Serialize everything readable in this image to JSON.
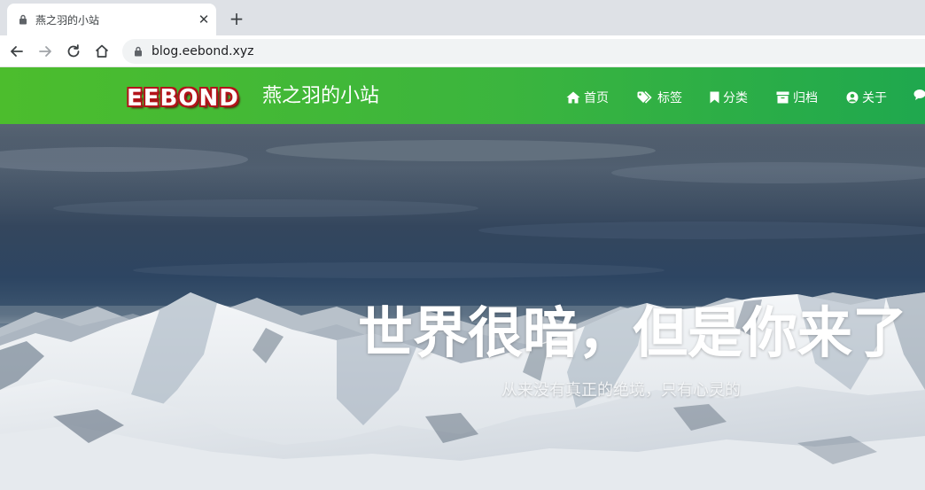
{
  "browser": {
    "tab_title": "燕之羽的小站",
    "url": "blog.eebond.xyz",
    "close_symbol": "✕",
    "new_tab_symbol": "+"
  },
  "site": {
    "logo_text": "EEBOND",
    "title": "燕之羽的小站",
    "nav": [
      {
        "label": "首页",
        "icon": "home-icon"
      },
      {
        "label": "标签",
        "icon": "tags-icon"
      },
      {
        "label": "分类",
        "icon": "bookmark-icon"
      },
      {
        "label": "归档",
        "icon": "archive-icon"
      },
      {
        "label": "关于",
        "icon": "user-circle-icon"
      },
      {
        "label": "",
        "icon": "comments-icon"
      }
    ]
  },
  "hero": {
    "title": "世界很暗，但是你来了",
    "subtitle": "从来没有真正的绝境，只有心灵的"
  },
  "colors": {
    "header_green_start": "#4cbd2d",
    "header_green_end": "#1fa84e",
    "tabstrip": "#dee1e6"
  }
}
